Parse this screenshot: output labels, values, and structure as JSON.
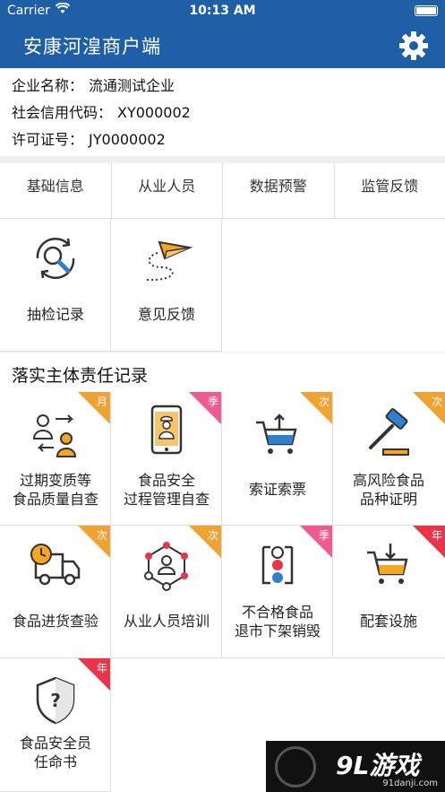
{
  "status_bar": {
    "carrier": "Carrier",
    "time": "10:13 AM"
  },
  "nav": {
    "title": "安康河湟商户端",
    "settings_icon": "gear-icon"
  },
  "company": {
    "name_label": "企业名称：",
    "name_value": "流通测试企业",
    "credit_label": "社会信用代码：",
    "credit_value": "XY000002",
    "license_label": "许可证号：",
    "license_value": "JY0000002"
  },
  "tabs": [
    {
      "label": "基础信息"
    },
    {
      "label": "从业人员"
    },
    {
      "label": "数据预警"
    },
    {
      "label": "监管反馈"
    }
  ],
  "quick_items": [
    {
      "label": "抽检记录",
      "icon": "magnifier-refresh-icon"
    },
    {
      "label": "意见反馈",
      "icon": "paper-plane-icon"
    }
  ],
  "section_title": "落实主体责任记录",
  "records": [
    {
      "line1": "过期变质等",
      "line2": "食品质量自查",
      "badge": "月",
      "icon": "people-exchange-icon"
    },
    {
      "line1": "食品安全",
      "line2": "过程管理自查",
      "badge": "季",
      "icon": "phone-chef-icon"
    },
    {
      "line1": "索证索票",
      "line2": "",
      "badge": "次",
      "icon": "cart-upload-icon"
    },
    {
      "line1": "高风险食品",
      "line2": "品种证明",
      "badge": "次",
      "icon": "gavel-icon"
    },
    {
      "line1": "食品进货查验",
      "line2": "",
      "badge": "次",
      "icon": "delivery-truck-icon"
    },
    {
      "line1": "从业人员培训",
      "line2": "",
      "badge": "次",
      "icon": "people-network-icon"
    },
    {
      "line1": "不合格食品",
      "line2": "退市下架销毁",
      "badge": "季",
      "icon": "traffic-cycle-icon"
    },
    {
      "line1": "配套设施",
      "line2": "",
      "badge": "年",
      "icon": "cart-download-icon"
    },
    {
      "line1": "食品安全员",
      "line2": "任命书",
      "badge": "年",
      "icon": "shield-question-icon"
    }
  ],
  "watermark": {
    "brand": "9L游戏",
    "url": "91danji.com"
  },
  "colors": {
    "nav_blue": "#1f5fa6",
    "badge_orange": "#f0a233",
    "badge_pink": "#ef5b8f",
    "badge_red": "#e8354a",
    "icon_orange": "#f5a623",
    "icon_blue": "#2f7fd0"
  }
}
